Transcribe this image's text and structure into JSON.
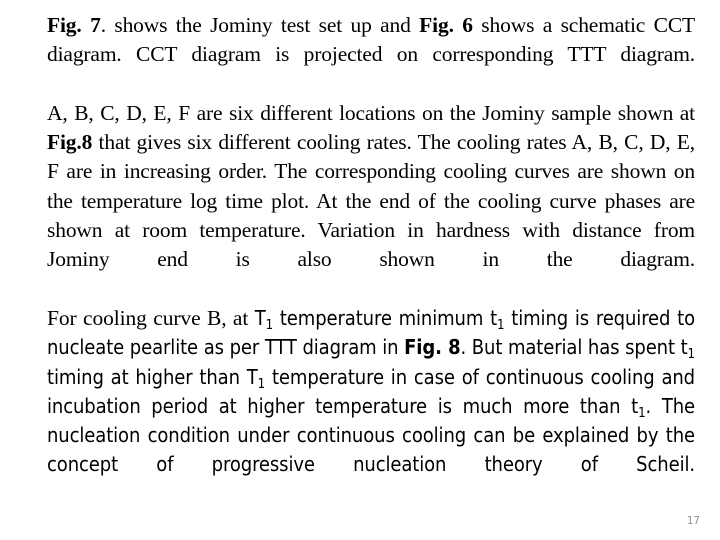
{
  "slide": {
    "background_color": "#ffffff",
    "text_color": "#000000",
    "page_number": "17",
    "page_number_color": "#8d8d8d"
  },
  "paragraphs": [
    {
      "id": "paragraph-1",
      "font": "serif",
      "runs": [
        {
          "text": "Fig. 7",
          "bold": true
        },
        {
          "text": ". shows the Jominy test set up and ",
          "bold": false
        },
        {
          "text": "Fig. 6",
          "bold": true
        },
        {
          "text": " shows a schematic CCT diagram. CCT diagram is projected on corresponding TTT diagram.",
          "bold": false
        }
      ],
      "plain_text": "Fig. 7. shows the Jominy test set up and Fig. 6 shows a schematic CCT diagram. CCT diagram is projected on corresponding TTT diagram."
    },
    {
      "id": "paragraph-2",
      "font": "serif",
      "runs": [
        {
          "text": "A, B, C, D, E, F are six different locations on the Jominy sample shown at ",
          "bold": false
        },
        {
          "text": "Fig.8",
          "bold": true
        },
        {
          "text": " that gives six different cooling rates. The cooling rates A, B, C, D, E, F are in increasing order. The corresponding cooling curves are shown on the temperature log time plot.  At the end of the cooling curve phases are shown at room temperature. Variation in hardness  with distance from Jominy end is also shown in the diagram.",
          "bold": false
        }
      ],
      "plain_text": "A, B, C, D, E, F are six different locations on the Jominy sample shown at Fig.8 that gives six different cooling rates. The cooling rates A, B, C, D, E, F are in increasing order. The corresponding cooling curves are shown on the temperature log time plot.  At the end of the cooling curve phases are shown at room temperature. Variation in hardness  with distance from Jominy end is also shown in the diagram."
    },
    {
      "id": "paragraph-3",
      "font": "sans",
      "runs": [
        {
          "text": "For cooling curve B, at ",
          "bold": false,
          "face": "serif"
        },
        {
          "text": "T",
          "bold": false,
          "subscript": "1"
        },
        {
          "text": " temperature minimum ",
          "bold": false
        },
        {
          "text": "t",
          "bold": false,
          "subscript": "1"
        },
        {
          "text": " timing is required to nucleate pearlite as per TTT diagram in ",
          "bold": false
        },
        {
          "text": "Fig. 8",
          "bold": true
        },
        {
          "text": ". But material has spent ",
          "bold": false
        },
        {
          "text": "t",
          "bold": false,
          "subscript": "1"
        },
        {
          "text": " timing at higher than ",
          "bold": false
        },
        {
          "text": "T",
          "bold": false,
          "subscript": "1"
        },
        {
          "text": "  temperature  in case of continuous cooling and incubation period at higher temperature  is much more than ",
          "bold": false
        },
        {
          "text": "t",
          "bold": false,
          "subscript": "1"
        },
        {
          "text": ". The nucleation condition under continuous cooling can be explained by the concept of progressive nucleation theory of Scheil.",
          "bold": false
        }
      ],
      "plain_text": "For cooling curve B, at T1 temperature minimum t1 timing is required to nucleate pearlite as per TTT diagram in Fig. 8. But material has spent t1 timing at higher than T1  temperature  in case of continuous cooling and incubation period at higher temperature  is much more than t1. The nucleation condition under continuous cooling can be explained by the concept of progressive nucleation theory of Scheil."
    }
  ],
  "p1": {
    "fig7": "Fig. 7",
    "after_fig7": ". shows the Jominy test set up and ",
    "fig6": "Fig. 6",
    "tail": " shows a schematic CCT diagram. CCT diagram is projected on corresponding TTT diagram."
  },
  "p2": {
    "head": "A, B, C, D, E, F are six different locations on the Jominy sample shown at ",
    "fig8": "Fig.8",
    "tail": " that gives six different cooling rates. The cooling rates A, B, C, D, E, F are in increasing order. The corresponding cooling curves are shown on the temperature log time plot.  At the end of the cooling curve phases are shown at room temperature. Variation in hardness  with distance from Jominy end is also shown in the diagram."
  },
  "p3": {
    "lead": "For cooling curve B, at ",
    "t_cap_1": "T",
    "sub_a": "1",
    "mid_1": " temperature minimum ",
    "t_low_1": "t",
    "sub_b": "1",
    "mid_2": " timing is required to nucleate pearlite as per TTT diagram in ",
    "fig8": "Fig. 8",
    "mid_3": ". But material has spent ",
    "t_low_2": "t",
    "sub_c": "1",
    "mid_4": " timing at higher than ",
    "t_cap_2": "T",
    "sub_d": "1",
    "mid_5": "  temperature  in case of continuous cooling and incubation period at higher temperature  is much more than ",
    "t_low_3": "t",
    "sub_e": "1",
    "tail": ". The nucleation condition under continuous cooling can be explained by the concept of progressive nucleation theory of Scheil."
  }
}
